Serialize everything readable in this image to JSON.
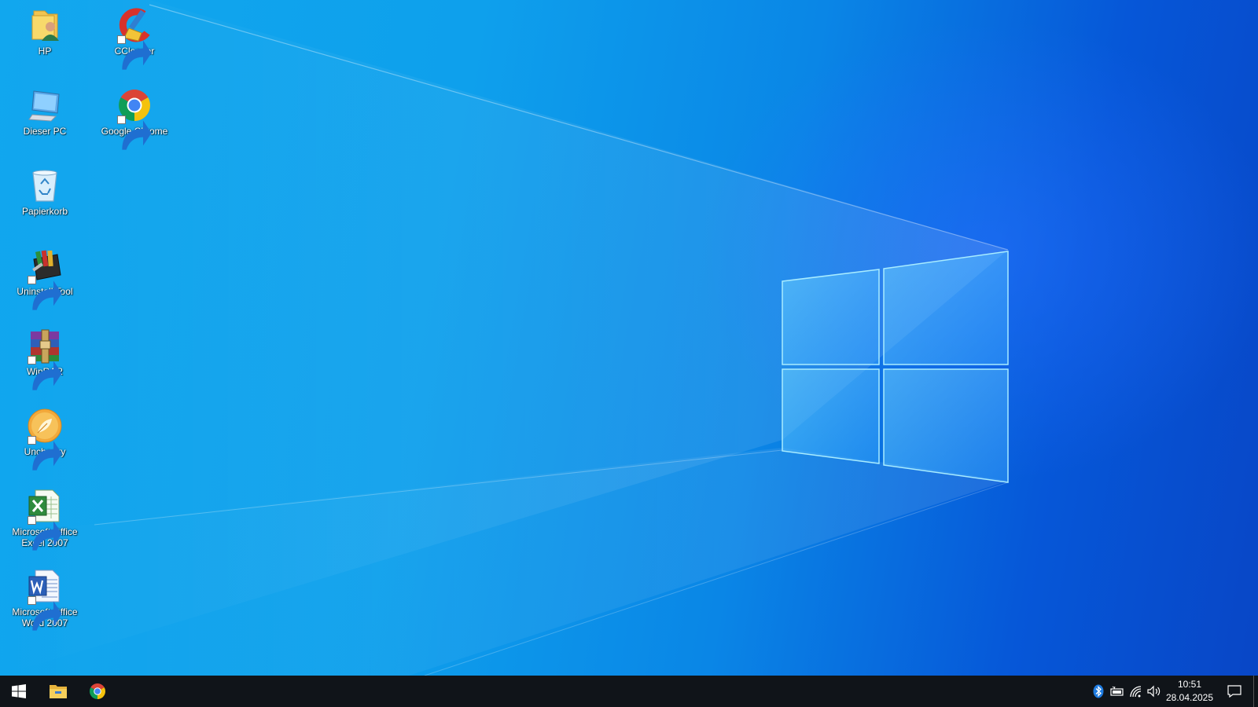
{
  "desktop": {
    "icons": [
      {
        "label": "HP",
        "icon": "user-folder-icon"
      },
      {
        "label": "CCleaner",
        "icon": "ccleaner-icon"
      },
      {
        "label": "Dieser PC",
        "icon": "computer-icon"
      },
      {
        "label": "Google Chrome",
        "icon": "chrome-icon"
      },
      {
        "label": "Papierkorb",
        "icon": "recycle-bin-icon"
      },
      {
        "label": "Uninstall Tool",
        "icon": "uninstall-tool-icon"
      },
      {
        "label": "WinRAR",
        "icon": "winrar-icon"
      },
      {
        "label": "Unchecky",
        "icon": "unchecky-icon"
      },
      {
        "label": "Microsoft Office Excel 2007",
        "icon": "excel-icon"
      },
      {
        "label": "Microsoft Office Word 2007",
        "icon": "word-icon"
      }
    ]
  },
  "taskbar": {
    "pinned": [
      "start-icon",
      "file-explorer-icon",
      "chrome-icon"
    ],
    "tray": [
      "bluetooth-icon",
      "battery-icon",
      "wifi-icon",
      "volume-icon"
    ],
    "time": "10:51",
    "date": "28.04.2025"
  },
  "colors": {
    "taskbar": "#101419",
    "wallpaper_light": "#11a7ee",
    "wallpaper_dark": "#0846c6"
  }
}
